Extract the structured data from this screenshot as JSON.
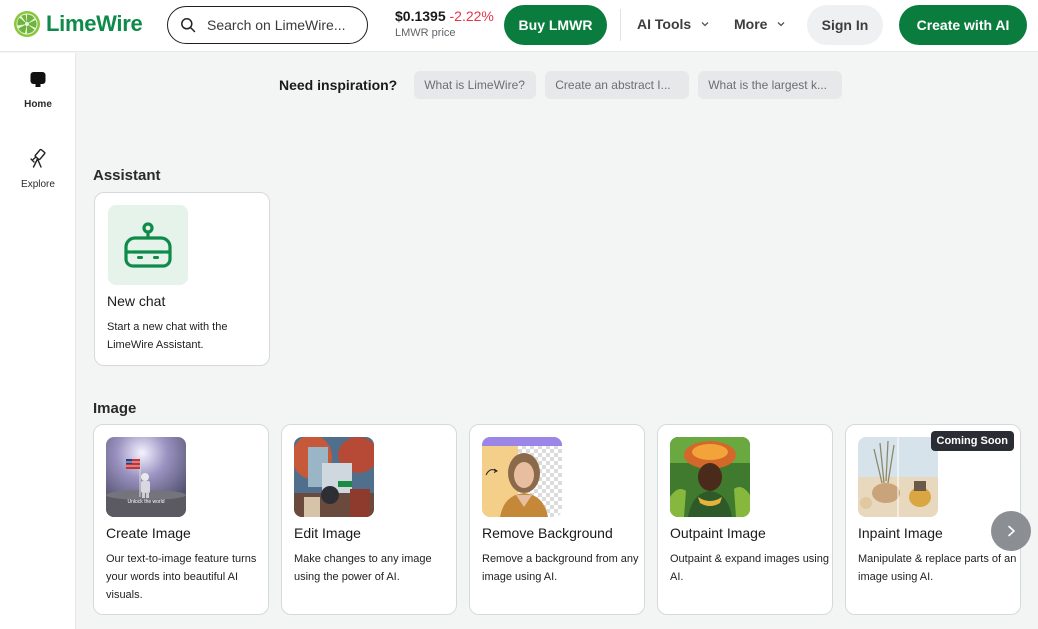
{
  "header": {
    "logo_text": "LimeWire",
    "search_placeholder": "Search on LimeWire...",
    "price_value": "$0.1395",
    "price_change": "-2.22%",
    "price_label": "LMWR price",
    "buy_label": "Buy LMWR",
    "nav": [
      {
        "label": "AI Tools",
        "icon": "chevron-down-icon"
      },
      {
        "label": "More",
        "icon": "chevron-down-icon"
      }
    ],
    "signin_label": "Sign In",
    "create_label": "Create with AI"
  },
  "sidebar": {
    "items": [
      {
        "label": "Home",
        "icon": "home-icon",
        "active": true
      },
      {
        "label": "Explore",
        "icon": "telescope-icon",
        "active": false
      }
    ]
  },
  "inspiration": {
    "label": "Need inspiration?",
    "chips": [
      "What is LimeWire?",
      "Create an abstract I...",
      "What is the largest k..."
    ]
  },
  "sections": {
    "assistant": {
      "title": "Assistant",
      "cards": [
        {
          "title": "New chat",
          "desc": "Start a new chat with the LimeWire Assistant.",
          "icon": "robot-icon"
        }
      ]
    },
    "image": {
      "title": "Image",
      "cards": [
        {
          "title": "Create Image",
          "desc": "Our text-to-image feature turns your words into beautiful AI visuals.",
          "thumb_caption": "Unlock the world"
        },
        {
          "title": "Edit Image",
          "desc": "Make changes to any image using the power of AI."
        },
        {
          "title": "Remove Background",
          "desc": "Remove a background from any image using AI."
        },
        {
          "title": "Outpaint Image",
          "desc": "Outpaint & expand images using AI."
        },
        {
          "title": "Inpaint Image",
          "desc": "Manipulate & replace parts of an image using AI.",
          "badge": "Coming Soon"
        }
      ]
    }
  },
  "colors": {
    "brand_green": "#0a7d3e",
    "price_down": "#e5364a",
    "background": "#f3f4f4"
  }
}
